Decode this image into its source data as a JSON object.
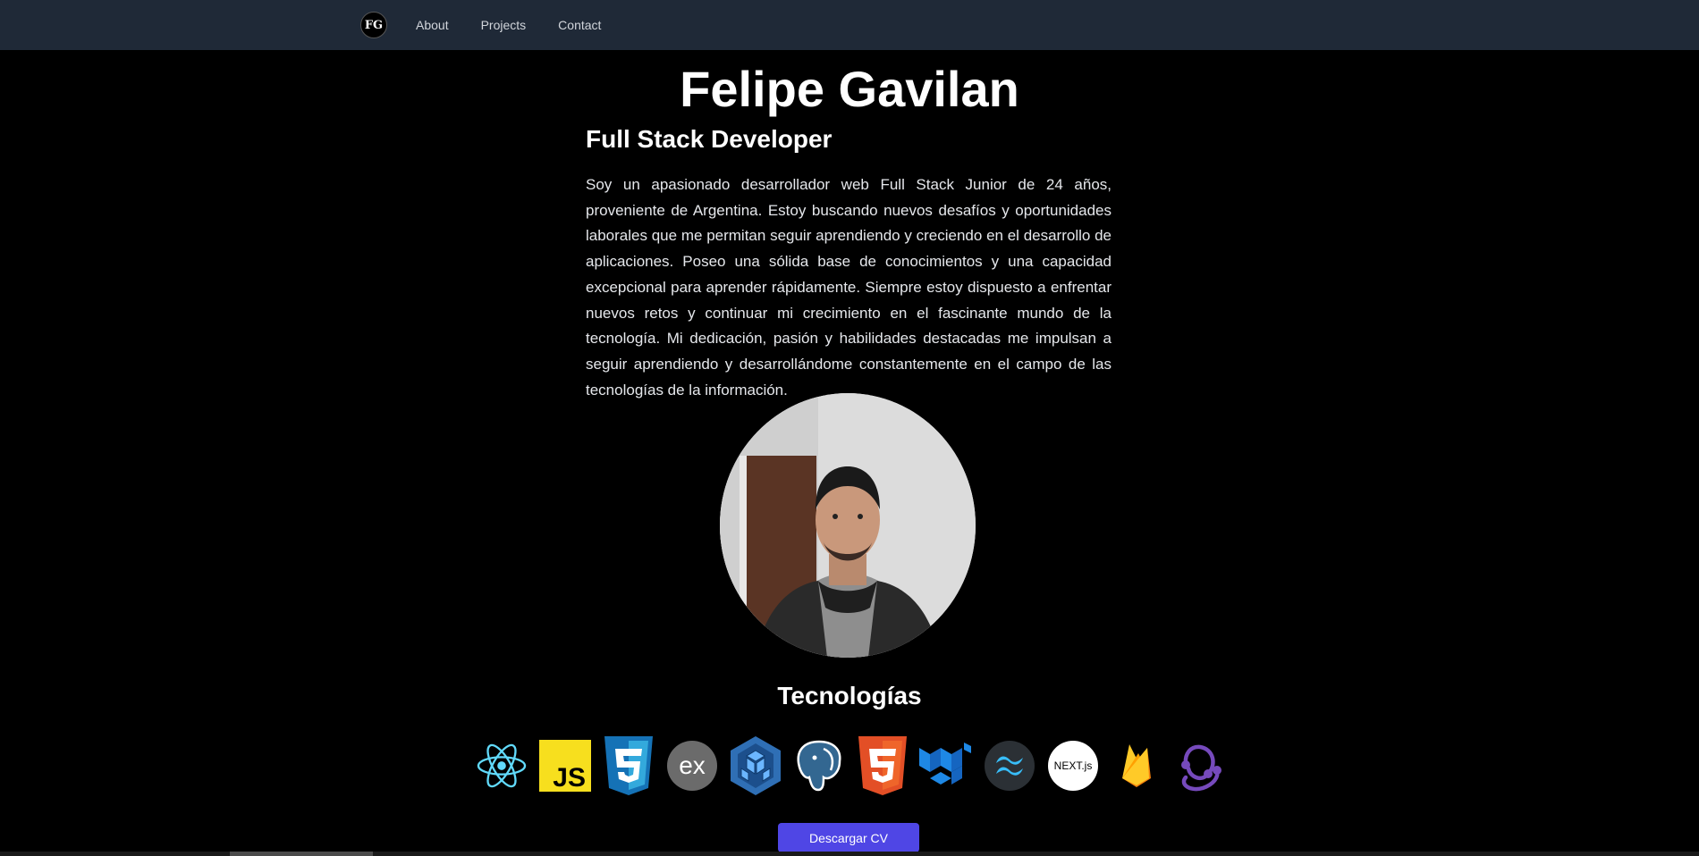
{
  "nav": {
    "logo_text": "FG",
    "links": [
      "About",
      "Projects",
      "Contact"
    ]
  },
  "hero": {
    "name": "Felipe Gavilan",
    "role": "Full Stack Developer",
    "bio": "Soy un apasionado desarrollador web Full Stack Junior de 24 años, proveniente de Argentina. Estoy buscando nuevos desafíos y oportunidades laborales que me permitan seguir aprendiendo y creciendo en el desarrollo de aplicaciones. Poseo una sólida base de conocimientos y una capacidad excepcional para aprender rápidamente. Siempre estoy dispuesto a enfrentar nuevos retos y continuar mi crecimiento en el fascinante mundo de la tecnología. Mi dedicación, pasión y habilidades destacadas me impulsan a seguir aprendiendo y desarrollándome constantemente en el campo de las tecnologías de la información."
  },
  "technologies": {
    "title": "Tecnologías",
    "items": [
      {
        "icon": "react-icon",
        "js_text": "",
        "color": "#61dafb"
      },
      {
        "icon": "javascript-icon",
        "js_text": "JS",
        "color": "#f7df1e"
      },
      {
        "icon": "css3-icon",
        "js_text": "",
        "color": "#1572b6"
      },
      {
        "icon": "express-icon",
        "js_text": "ex",
        "color": "#6b6b6b"
      },
      {
        "icon": "sequelize-icon",
        "js_text": "",
        "color": "#2f6fb5"
      },
      {
        "icon": "postgresql-icon",
        "js_text": "",
        "color": "#336791"
      },
      {
        "icon": "html5-icon",
        "js_text": "",
        "color": "#e34f26"
      },
      {
        "icon": "material-ui-icon",
        "js_text": "",
        "color": "#1e88e5"
      },
      {
        "icon": "tailwind-icon",
        "js_text": "",
        "color": "#38bdf8"
      },
      {
        "icon": "nextjs-icon",
        "js_text": "NEXT.js",
        "color": "#ffffff"
      },
      {
        "icon": "firebase-icon",
        "js_text": "",
        "color": "#ffca28"
      },
      {
        "icon": "redux-icon",
        "js_text": "",
        "color": "#764abc"
      }
    ]
  },
  "cta": {
    "download_cv": "Descargar CV"
  },
  "colors": {
    "navbar_bg": "#1f2937",
    "page_bg": "#000000",
    "accent": "#4f46e5"
  }
}
